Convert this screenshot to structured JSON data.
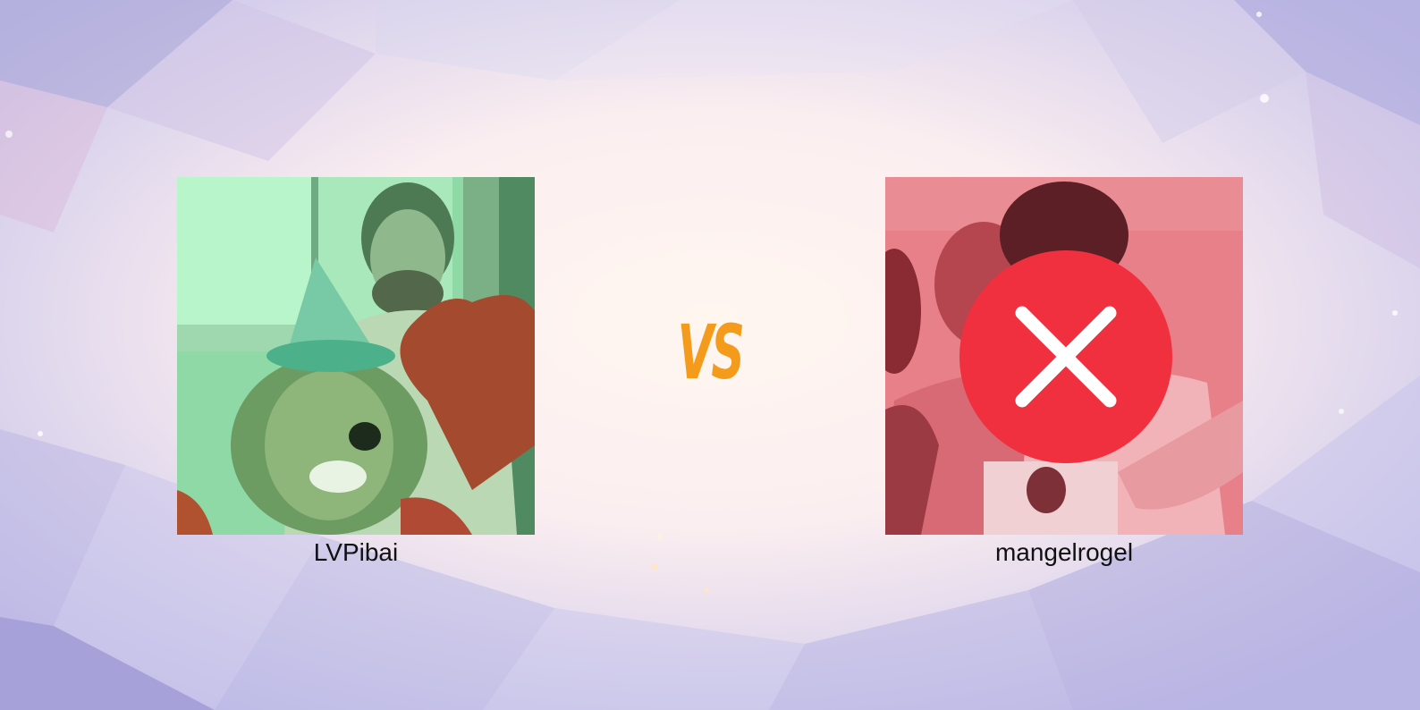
{
  "match": {
    "vs_label": "VS"
  },
  "left_player": {
    "name": "LVPibai",
    "status": "winner",
    "overlay_color": "#86e6ad"
  },
  "right_player": {
    "name": "mangelrogel",
    "status": "eliminated",
    "overlay_color": "#e8707d",
    "badge_icon": "close-icon",
    "badge_color": "#f0303f"
  },
  "colors": {
    "vs": "#f49b1b",
    "background_light": "#fbeef0",
    "background_shade": "#b8b6e4"
  }
}
